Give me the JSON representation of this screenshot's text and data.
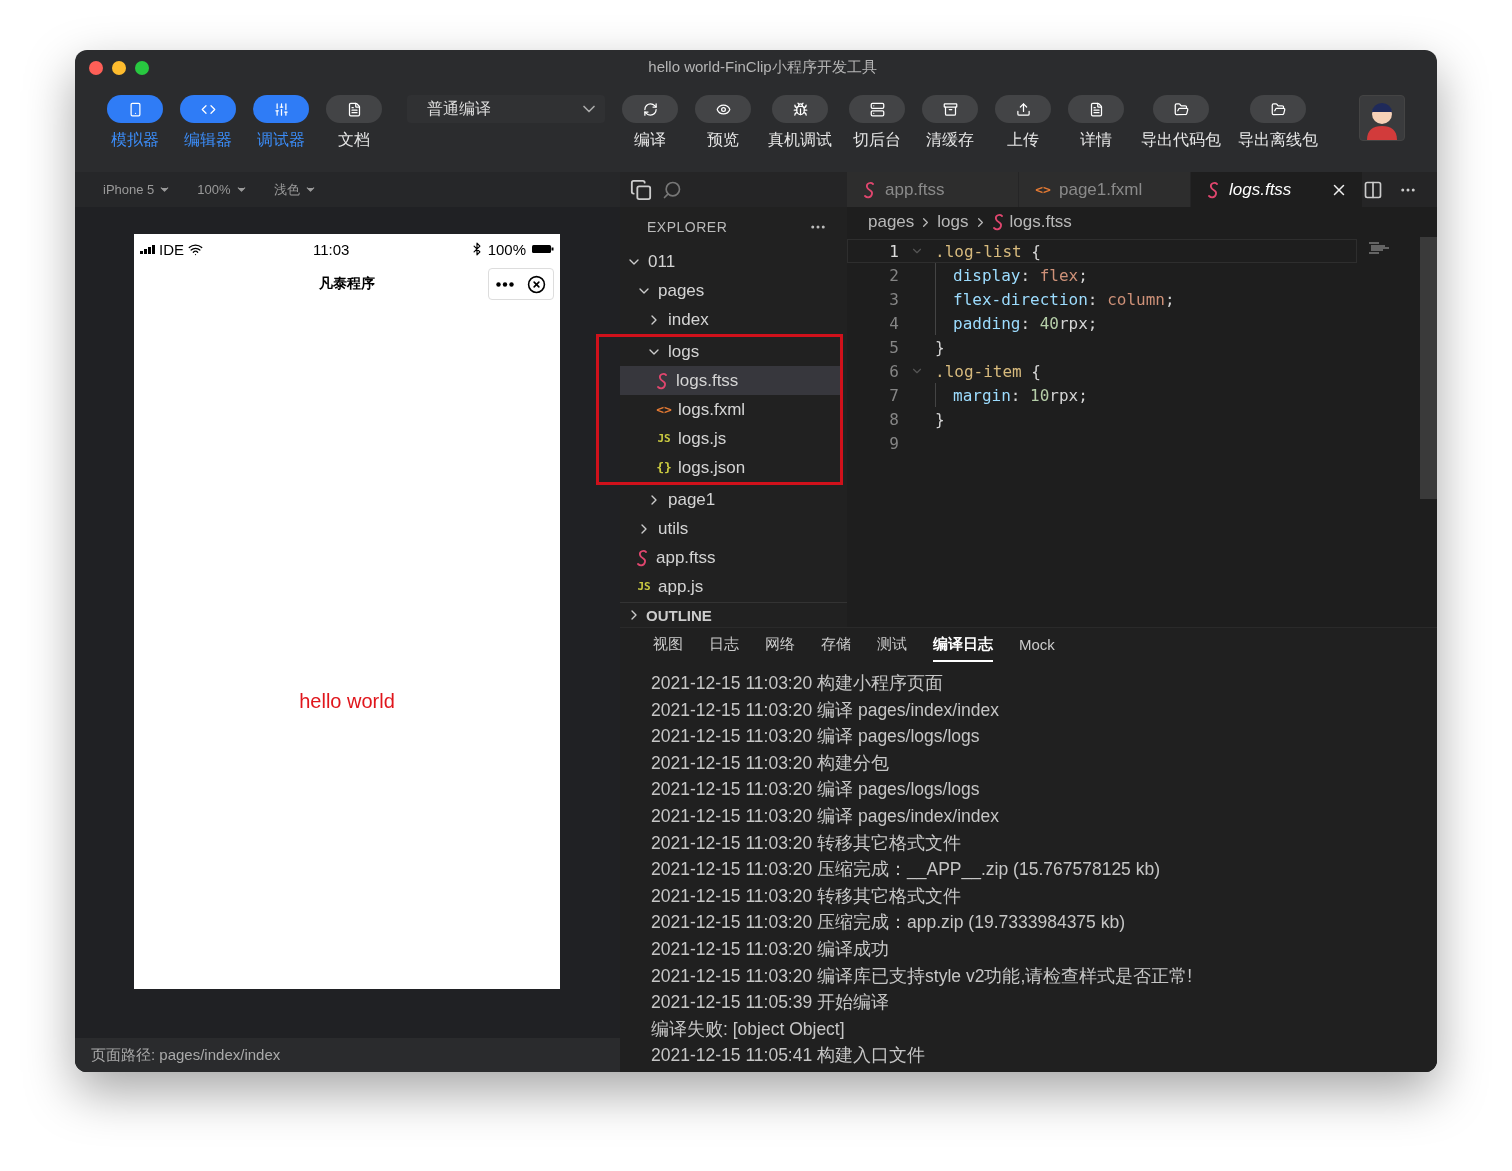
{
  "window": {
    "title": "hello world-FinClip小程序开发工具"
  },
  "toolbar": {
    "modes": [
      {
        "label": "模拟器",
        "on": true
      },
      {
        "label": "编辑器",
        "on": true
      },
      {
        "label": "调试器",
        "on": true
      },
      {
        "label": "文档",
        "on": false
      }
    ],
    "compile_mode": {
      "value": "普通编译"
    },
    "actions": [
      {
        "label": "编译"
      },
      {
        "label": "预览"
      },
      {
        "label": "真机调试"
      },
      {
        "label": "切后台"
      },
      {
        "label": "清缓存"
      },
      {
        "label": "上传"
      },
      {
        "label": "详情"
      },
      {
        "label": "导出代码包"
      },
      {
        "label": "导出离线包"
      }
    ]
  },
  "simulator": {
    "controls": [
      {
        "label": "iPhone 5"
      },
      {
        "label": "100%"
      },
      {
        "label": "浅色"
      }
    ],
    "phone": {
      "carrier": "IDE",
      "time": "11:03",
      "battery": "100%",
      "title": "凡泰程序",
      "content": "hello world"
    },
    "page_path": "页面路径: pages/index/index"
  },
  "explorer": {
    "title": "EXPLORER",
    "tree": [
      {
        "label": "011",
        "kind": "folder",
        "expanded": true,
        "selected": false,
        "children": [
          {
            "label": "pages",
            "kind": "folder",
            "expanded": true,
            "selected": false,
            "children": [
              {
                "label": "index",
                "kind": "folder",
                "expanded": false,
                "selected": false
              },
              {
                "label": "logs",
                "kind": "folder",
                "expanded": true,
                "selected": false,
                "highlighted": true,
                "children": [
                  {
                    "label": "logs.ftss",
                    "kind": "ftss",
                    "selected": true
                  },
                  {
                    "label": "logs.fxml",
                    "kind": "fxml",
                    "glyph": "<>",
                    "selected": false
                  },
                  {
                    "label": "logs.js",
                    "kind": "js",
                    "glyph": "JS",
                    "selected": false
                  },
                  {
                    "label": "logs.json",
                    "kind": "json",
                    "glyph": "{}",
                    "selected": false
                  }
                ]
              },
              {
                "label": "page1",
                "kind": "folder",
                "expanded": false,
                "selected": false
              }
            ]
          },
          {
            "label": "utils",
            "kind": "folder",
            "expanded": false,
            "selected": false
          },
          {
            "label": "app.ftss",
            "kind": "ftss",
            "selected": false
          },
          {
            "label": "app.js",
            "kind": "js",
            "glyph": "JS",
            "selected": false
          }
        ]
      }
    ],
    "outline": {
      "title": "OUTLINE",
      "expanded": false
    }
  },
  "editor": {
    "tabs": [
      {
        "label": "app.ftss",
        "kind": "ftss",
        "selected": false
      },
      {
        "label": "page1.fxml",
        "kind": "fxml",
        "glyph": "<>",
        "selected": false
      },
      {
        "label": "logs.ftss",
        "kind": "ftss",
        "selected": true
      }
    ],
    "breadcrumb": [
      {
        "label": "pages",
        "kind": "folder"
      },
      {
        "label": "logs",
        "kind": "folder"
      },
      {
        "label": "logs.ftss",
        "kind": "ftss"
      }
    ],
    "lines": [
      {
        "number": "1",
        "foldable": true,
        "current": true,
        "indent": false,
        "tokens": [
          {
            "text": ".log-list",
            "kind": "selector"
          },
          {
            "text": " {",
            "kind": "punct"
          }
        ]
      },
      {
        "number": "2",
        "foldable": false,
        "current": false,
        "indent": true,
        "tokens": [
          {
            "text": "display",
            "kind": "property"
          },
          {
            "text": ": ",
            "kind": "punct"
          },
          {
            "text": "flex",
            "kind": "value"
          },
          {
            "text": ";",
            "kind": "punct"
          }
        ]
      },
      {
        "number": "3",
        "foldable": false,
        "current": false,
        "indent": true,
        "tokens": [
          {
            "text": "flex-direction",
            "kind": "property"
          },
          {
            "text": ": ",
            "kind": "punct"
          },
          {
            "text": "column",
            "kind": "value"
          },
          {
            "text": ";",
            "kind": "punct"
          }
        ]
      },
      {
        "number": "4",
        "foldable": false,
        "current": false,
        "indent": true,
        "tokens": [
          {
            "text": "padding",
            "kind": "property"
          },
          {
            "text": ": ",
            "kind": "punct"
          },
          {
            "text": "40",
            "kind": "number"
          },
          {
            "text": "rpx;",
            "kind": "punct"
          }
        ]
      },
      {
        "number": "5",
        "foldable": false,
        "current": false,
        "indent": false,
        "tokens": [
          {
            "text": "}",
            "kind": "punct"
          }
        ]
      },
      {
        "number": "6",
        "foldable": true,
        "current": false,
        "indent": false,
        "tokens": [
          {
            "text": ".log-item",
            "kind": "selector"
          },
          {
            "text": " {",
            "kind": "punct"
          }
        ]
      },
      {
        "number": "7",
        "foldable": false,
        "current": false,
        "indent": true,
        "tokens": [
          {
            "text": "margin",
            "kind": "property"
          },
          {
            "text": ": ",
            "kind": "punct"
          },
          {
            "text": "10",
            "kind": "number"
          },
          {
            "text": "rpx;",
            "kind": "punct"
          }
        ]
      },
      {
        "number": "8",
        "foldable": false,
        "current": false,
        "indent": false,
        "tokens": [
          {
            "text": "}",
            "kind": "punct"
          }
        ]
      },
      {
        "number": "9",
        "foldable": false,
        "current": false,
        "indent": false
      }
    ]
  },
  "console": {
    "tabs": [
      {
        "label": "视图",
        "selected": false
      },
      {
        "label": "日志",
        "selected": false
      },
      {
        "label": "网络",
        "selected": false
      },
      {
        "label": "存储",
        "selected": false
      },
      {
        "label": "测试",
        "selected": false
      },
      {
        "label": "编译日志",
        "selected": true
      },
      {
        "label": "Mock",
        "selected": false
      }
    ],
    "lines": [
      "2021-12-15 11:03:20 构建小程序页面",
      "2021-12-15 11:03:20 编译 pages/index/index",
      "2021-12-15 11:03:20 编译 pages/logs/logs",
      "2021-12-15 11:03:20 构建分包",
      "2021-12-15 11:03:20 编译 pages/logs/logs",
      "2021-12-15 11:03:20 编译 pages/index/index",
      "2021-12-15 11:03:20 转移其它格式文件",
      "2021-12-15 11:03:20 压缩完成：__APP__.zip (15.767578125 kb)",
      "2021-12-15 11:03:20 转移其它格式文件",
      "2021-12-15 11:03:20 压缩完成：app.zip (19.7333984375 kb)",
      "2021-12-15 11:03:20 编译成功",
      "2021-12-15 11:03:20 编译库已支持style v2功能,请检查样式是否正常!",
      "2021-12-15 11:05:39 开始编译",
      "编译失败: [object Object]",
      "2021-12-15 11:05:41 构建入口文件"
    ]
  }
}
